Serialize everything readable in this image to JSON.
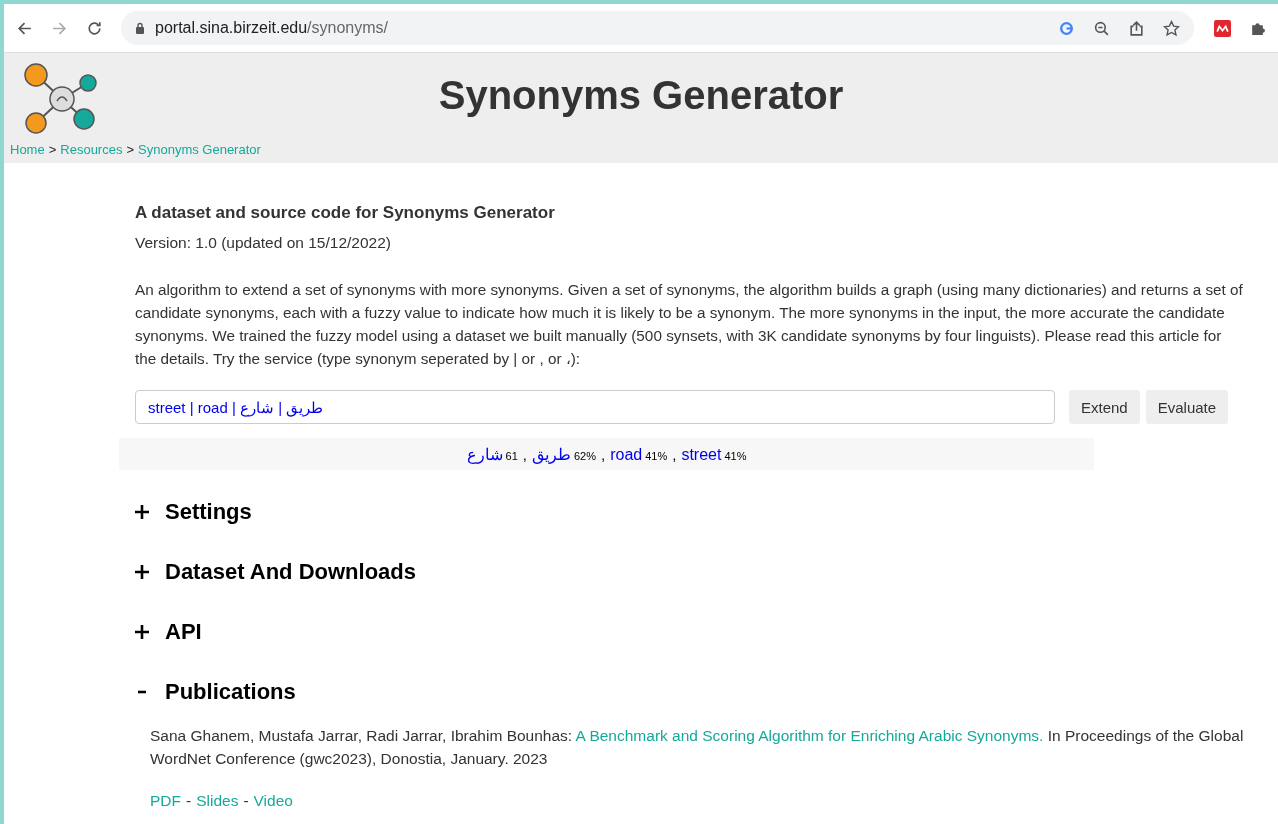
{
  "browser": {
    "url_host": "portal.sina.birzeit.edu",
    "url_path": "/synonyms/"
  },
  "header": {
    "title": "Synonyms Generator",
    "breadcrumb": [
      {
        "label": "Home"
      },
      {
        "label": "Resources"
      },
      {
        "label": "Synonyms Generator"
      }
    ],
    "breadcrumb_separator": ">"
  },
  "intro": {
    "heading": "A dataset and source code for Synonyms Generator",
    "version": "Version: 1.0 (updated on 15/12/2022)",
    "description": "An algorithm to extend a set of synonyms with more synonyms. Given a set of synonyms, the algorithm builds a graph (using many dictionaries) and returns a set of candidate synonyms, each with a fuzzy value to indicate how much it is likely to be a synonym. The more synonyms in the input, the more accurate the candidate synonyms. We trained the fuzzy model using a dataset we built manually (500 synsets, with 3K candidate synonyms by four linguists). Please read this article for the details. Try the service (type synonym seperated by | or , or ،):"
  },
  "input": {
    "value": "street | road | طريق | شارع"
  },
  "buttons": [
    {
      "label": "Extend"
    },
    {
      "label": "Evaluate"
    }
  ],
  "results": {
    "separator": ",",
    "items": [
      {
        "word": "شارع",
        "score": "61"
      },
      {
        "word": "طريق",
        "score": "62%"
      },
      {
        "word": "road",
        "score": "41%"
      },
      {
        "word": "street",
        "score": "41%"
      }
    ]
  },
  "sections": [
    {
      "title": "Settings",
      "expanded": false
    },
    {
      "title": "Dataset And Downloads",
      "expanded": false
    },
    {
      "title": "API",
      "expanded": false
    },
    {
      "title": "Publications",
      "expanded": true
    }
  ],
  "publication": {
    "authors": "Sana Ghanem, Mustafa Jarrar, Radi Jarrar, Ibrahim Bounhas:",
    "link": "A Benchmark and Scoring Algorithm for Enriching Arabic Synonyms.",
    "venue": "In Proceedings of the Global WordNet Conference (gwc2023), Donostia, January. 2023",
    "links": [
      {
        "label": "PDF"
      },
      {
        "label": "Slides"
      },
      {
        "label": "Video"
      }
    ],
    "links_separator": "-"
  }
}
